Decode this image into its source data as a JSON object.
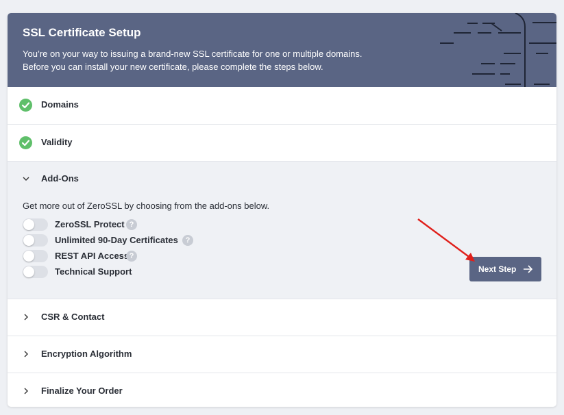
{
  "header": {
    "title": "SSL Certificate Setup",
    "description_line1": "You’re on your way to issuing a brand-new SSL certificate for one or multiple domains.",
    "description_line2": "Before you can install your new certificate, please complete the steps below."
  },
  "steps": {
    "domains": {
      "label": "Domains",
      "status_icon": "check-circle-icon"
    },
    "validity": {
      "label": "Validity",
      "status_icon": "check-circle-icon"
    },
    "addons": {
      "label": "Add-Ons",
      "description": "Get more out of ZeroSSL by choosing from the add-ons below.",
      "items": [
        {
          "label": "ZeroSSL Protect",
          "enabled": false,
          "help": "?"
        },
        {
          "label": "Unlimited 90-Day Certificates",
          "enabled": false,
          "help": "?"
        },
        {
          "label": "REST API Access",
          "enabled": false,
          "help": "?"
        },
        {
          "label": "Technical Support",
          "enabled": false
        }
      ],
      "next_button": "Next Step"
    },
    "csr": {
      "label": "CSR & Contact"
    },
    "encryption": {
      "label": "Encryption Algorithm"
    },
    "finalize": {
      "label": "Finalize Your Order"
    }
  },
  "colors": {
    "header_bg": "#5a6584",
    "check_green": "#5fbf6a",
    "annotation_red": "#e0201b"
  }
}
